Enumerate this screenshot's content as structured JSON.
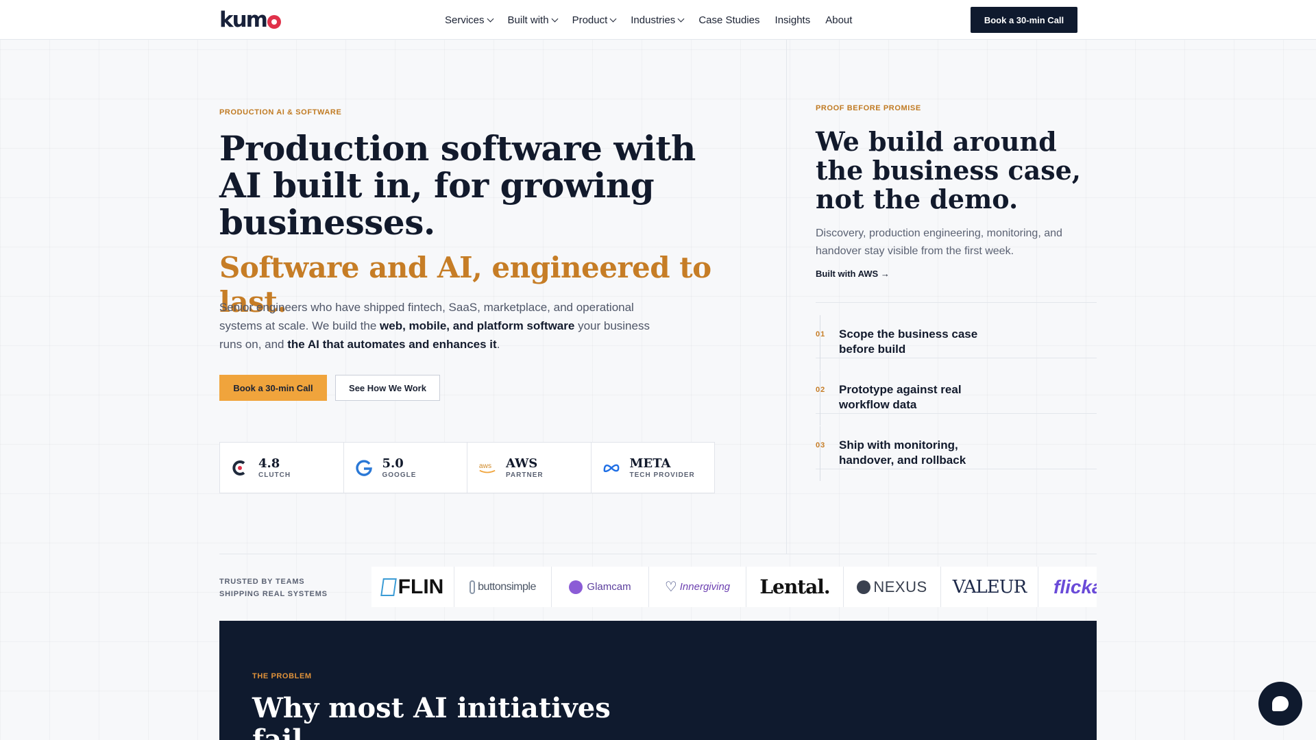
{
  "nav": {
    "logo_text": "kum",
    "menu": [
      {
        "label": "Services",
        "dropdown": true
      },
      {
        "label": "Built with",
        "dropdown": true
      },
      {
        "label": "Product",
        "dropdown": true
      },
      {
        "label": "Industries",
        "dropdown": true
      },
      {
        "label": "Case Studies",
        "dropdown": false
      },
      {
        "label": "Insights",
        "dropdown": false
      },
      {
        "label": "About",
        "dropdown": false
      }
    ],
    "cta": "Book a 30-min Call"
  },
  "hero": {
    "eyebrow": "PRODUCTION AI & SOFTWARE",
    "title": "Production software with AI built in, for growing businesses.",
    "subtitle": "Software and AI, engineered to last.",
    "body": {
      "p1": "Senior engineers who have shipped fintech, SaaS, marketplace, and operational systems at scale. We build the ",
      "b1": "web, mobile, and platform software",
      "p2": " your business runs on, and ",
      "b2": "the AI that automates and enhances it",
      "p3": "."
    },
    "primary_button": "Book a 30-min Call",
    "secondary_button": "See How We Work",
    "badges": [
      {
        "main": "4.8",
        "sub": "CLUTCH",
        "icon": "clutch-icon"
      },
      {
        "main": "5.0",
        "sub": "GOOGLE",
        "icon": "google-icon"
      },
      {
        "main": "AWS",
        "sub": "PARTNER",
        "icon": "aws-icon"
      },
      {
        "main": "META",
        "sub": "TECH PROVIDER",
        "icon": "meta-icon"
      }
    ]
  },
  "proof": {
    "eyebrow": "PROOF BEFORE PROMISE",
    "title": "We build around the business case, not the demo.",
    "body": "Discovery, production engineering, monitoring, and handover stay visible from the first week.",
    "link": "Built with AWS →",
    "steps": [
      {
        "num": "01",
        "text": "Scope the business case before build"
      },
      {
        "num": "02",
        "text": "Prototype against real workflow data"
      },
      {
        "num": "03",
        "text": "Ship with monitoring, handover, and rollback"
      }
    ]
  },
  "trusted": {
    "label": "TRUSTED BY TEAMS SHIPPING REAL SYSTEMS",
    "logos": [
      "FLIN",
      "buttonsimple",
      "Glamcam",
      "Innergiving",
      "Lental.",
      "NEXUS",
      "VALEUR",
      "flicka"
    ]
  },
  "problem": {
    "eyebrow": "THE PROBLEM",
    "title": "Why most AI initiatives fail"
  },
  "colors": {
    "navy": "#0f1a2e",
    "accent_orange": "#c67d26",
    "button_orange": "#f0a43c",
    "logo_red": "#e0314a"
  }
}
